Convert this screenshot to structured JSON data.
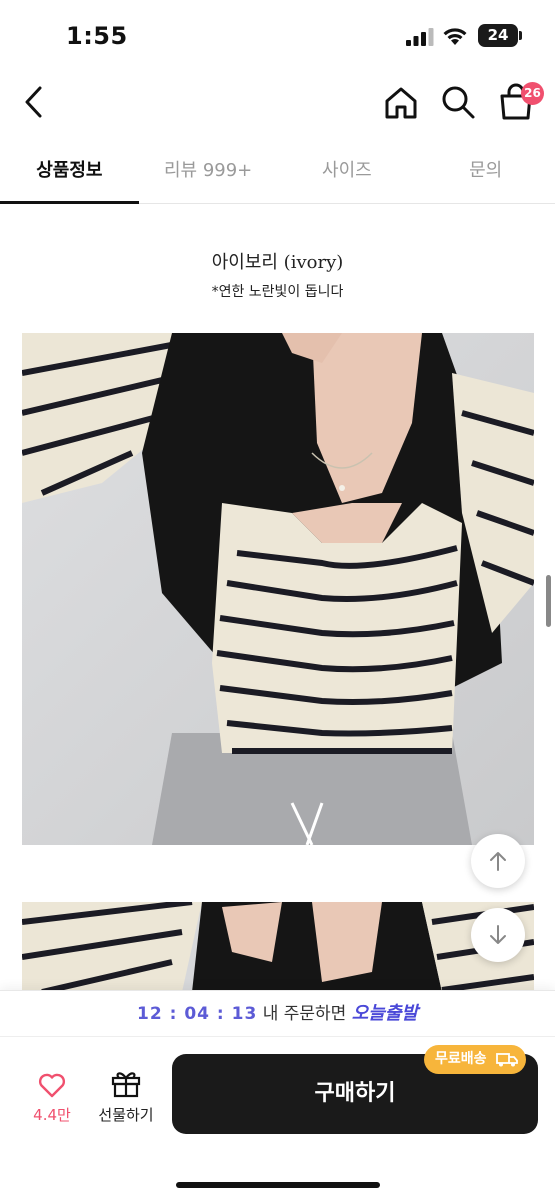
{
  "status_bar": {
    "time": "1:55",
    "battery": "24"
  },
  "header": {
    "cart_count": "26"
  },
  "tabs": [
    {
      "label": "상품정보",
      "active": true
    },
    {
      "label": "리뷰 999+",
      "active": false
    },
    {
      "label": "사이즈",
      "active": false
    },
    {
      "label": "문의",
      "active": false
    }
  ],
  "product": {
    "color_title": "아이보리 (ivory)",
    "color_note": "*연한 노란빛이 돕니다"
  },
  "shipping": {
    "countdown": "12 : 04 : 13",
    "message": "내 주문하면",
    "today_label": "오늘출발"
  },
  "actions": {
    "like_count": "4.4만",
    "gift_label": "선물하기",
    "buy_label": "구매하기",
    "free_shipping_label": "무료배송"
  },
  "colors": {
    "accent_pink": "#f0506e",
    "shipping_purple": "#4a48d8",
    "badge_orange": "#f7b53b"
  }
}
